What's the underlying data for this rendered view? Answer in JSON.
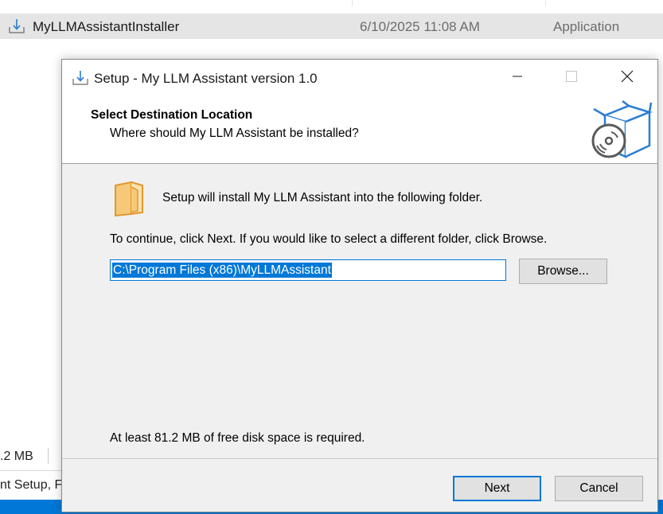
{
  "background": {
    "file_row": {
      "name": "MyLLMAssistantInstaller",
      "date": "6/10/2025 11:08 AM",
      "type": "Application",
      "icon": "installer-icon"
    },
    "size_fragment": ".2 MB",
    "description_fragment": "nt Setup, F"
  },
  "dialog": {
    "title": "Setup - My LLM Assistant version 1.0",
    "title_icon": "installer-icon",
    "controls": {
      "minimize": "minimize-icon",
      "maximize": "maximize-icon",
      "close": "close-icon"
    },
    "header": {
      "title": "Select Destination Location",
      "subtitle": "Where should My LLM Assistant be installed?",
      "icon": "package-disc-icon"
    },
    "intro": "Setup will install My LLM Assistant into the following folder.",
    "instruction": "To continue, click Next. If you would like to select a different folder, click Browse.",
    "path_value": "C:\\Program Files (x86)\\MyLLMAssistant",
    "browse_label": "Browse...",
    "disk_space": "At least 81.2 MB of free disk space is required.",
    "next_label": "Next",
    "cancel_label": "Cancel"
  },
  "colors": {
    "accent": "#0078d7",
    "dialog_bg": "#f0f0f0",
    "folder": "#f6c879"
  }
}
